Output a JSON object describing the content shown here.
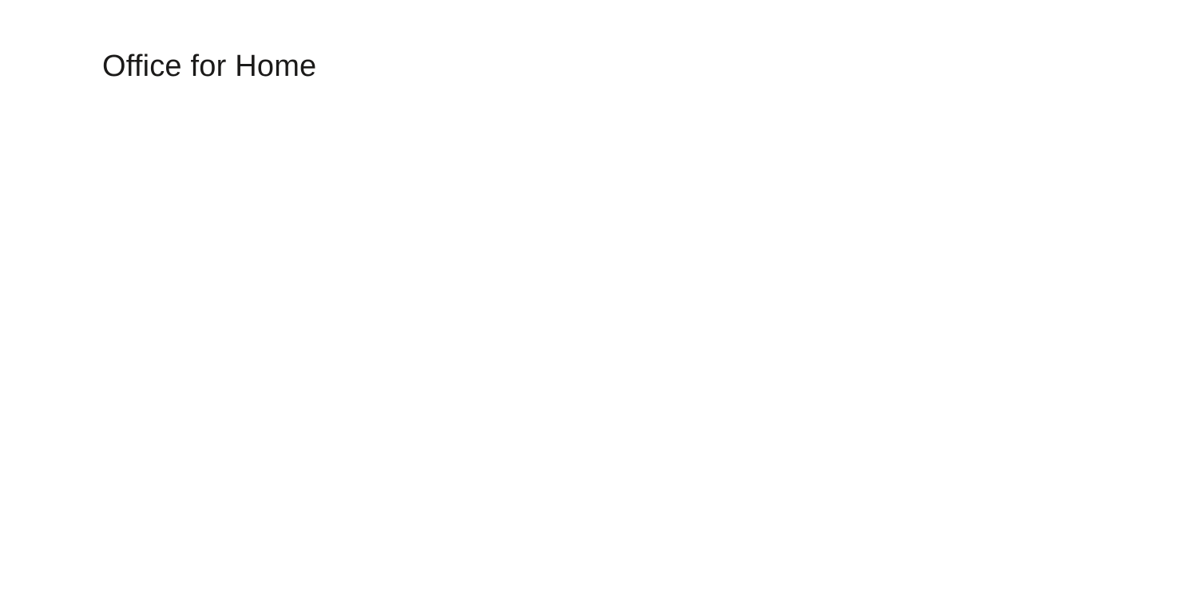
{
  "heading": {
    "text": "Office for Home"
  }
}
